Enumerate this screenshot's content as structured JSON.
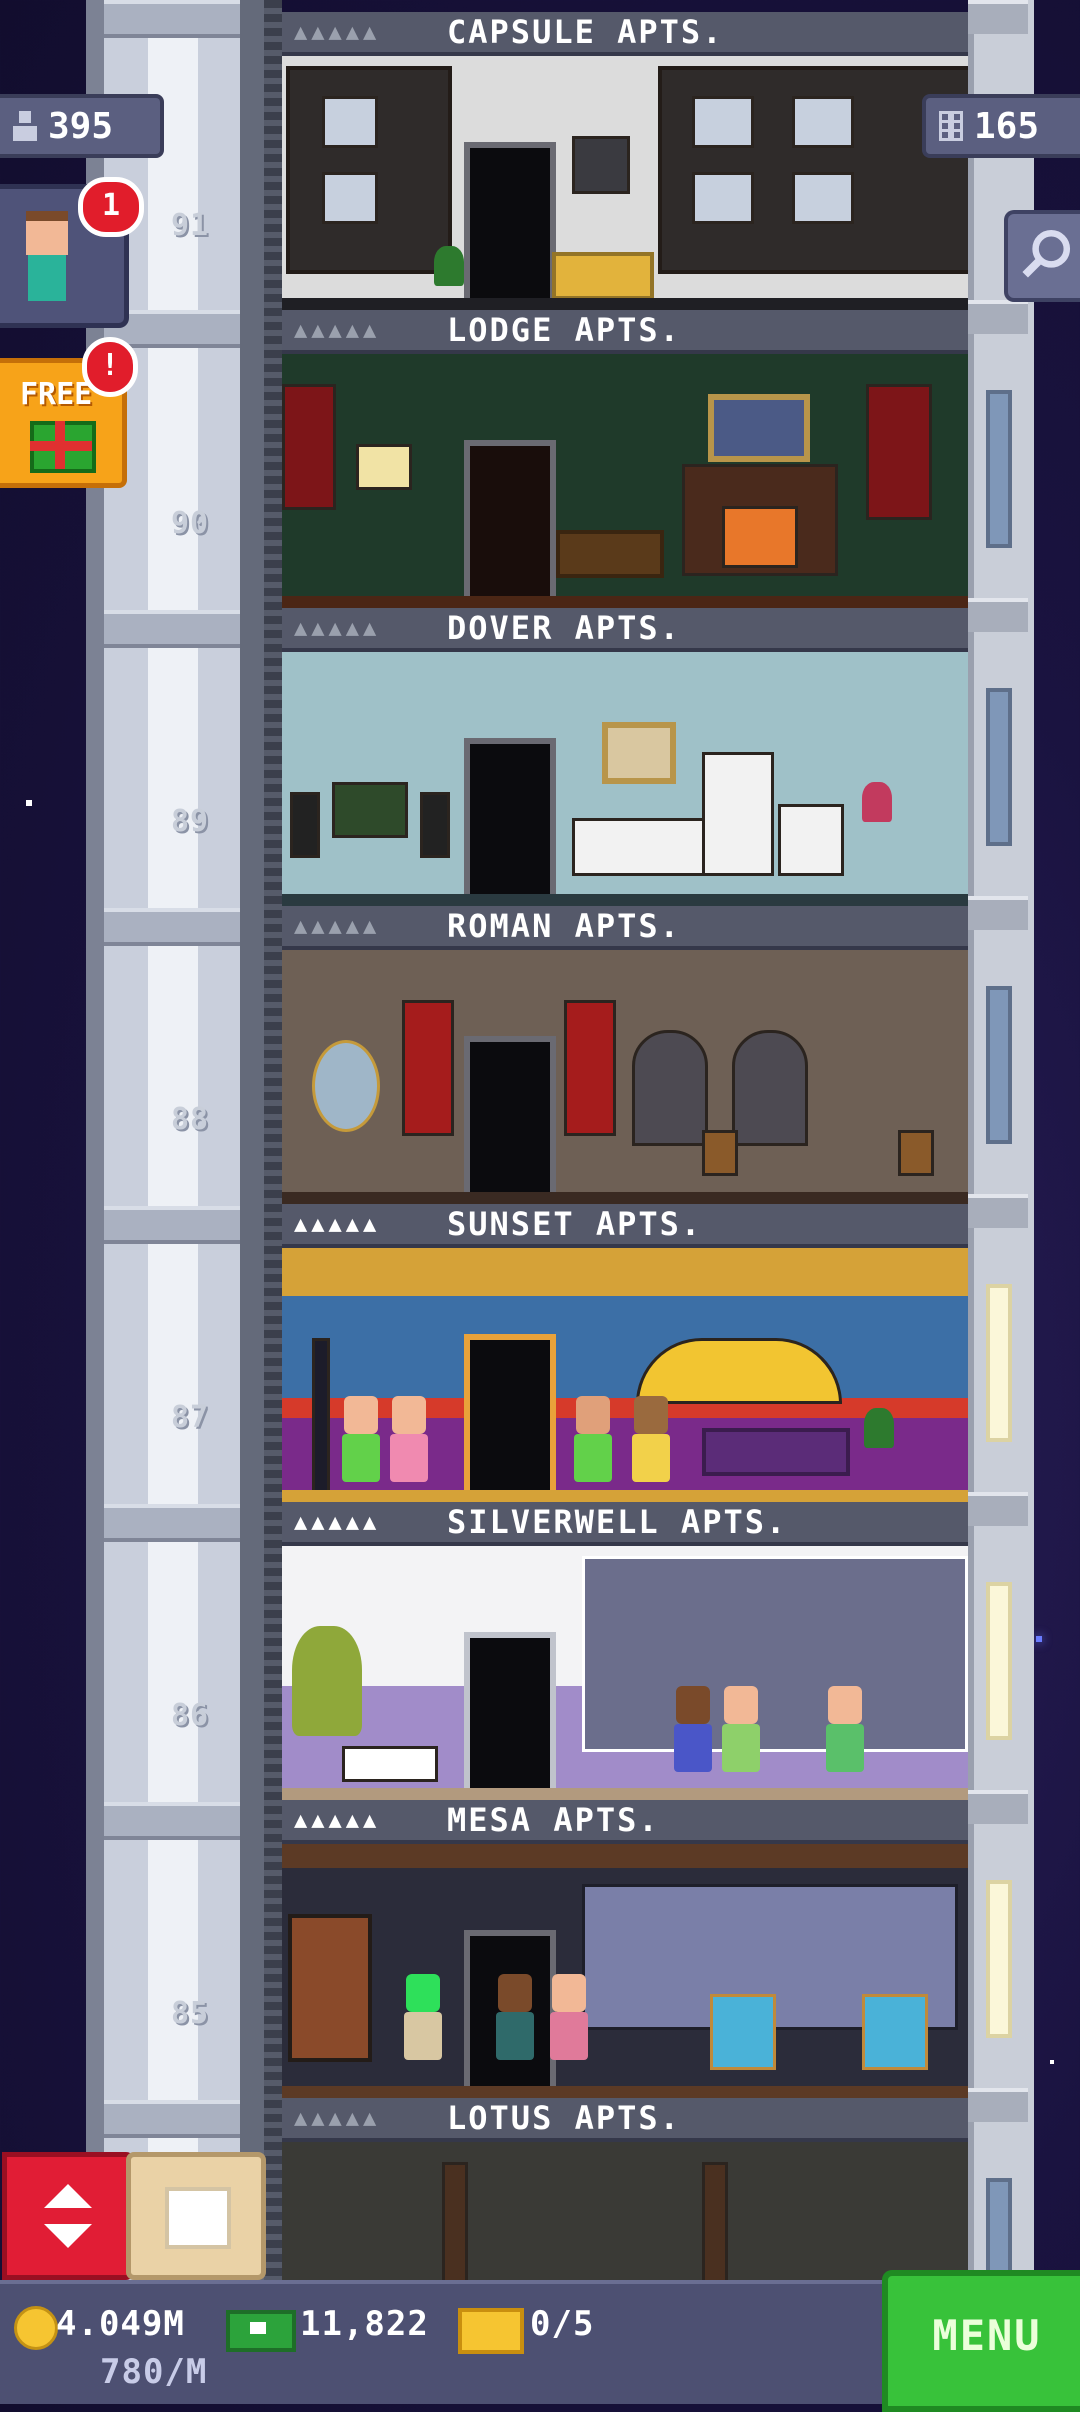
{
  "hud": {
    "population": "395",
    "floors_count": "165",
    "vip_alert_count": "1",
    "free_alert": "!",
    "free_label": "FREE",
    "coins": "4.049M",
    "coin_rate": "780/M",
    "tower_bux": "11,822",
    "tickets": "0/5",
    "menu_label": "MENU"
  },
  "floor_numbers": [
    "91",
    "90",
    "89",
    "88",
    "87",
    "86",
    "85"
  ],
  "floors": [
    {
      "name": "CAPSULE APTS.",
      "stars": "▲▲▲▲▲",
      "filled": false
    },
    {
      "name": "LODGE APTS.",
      "stars": "▲▲▲▲▲",
      "filled": false
    },
    {
      "name": "DOVER APTS.",
      "stars": "▲▲▲▲▲",
      "filled": false
    },
    {
      "name": "ROMAN APTS.",
      "stars": "▲▲▲▲▲",
      "filled": false
    },
    {
      "name": "SUNSET APTS.",
      "stars": "▲▲▲▲▲",
      "filled": true
    },
    {
      "name": "SILVERWELL APTS.",
      "stars": "▲▲▲▲▲",
      "filled": true
    },
    {
      "name": "MESA APTS.",
      "stars": "▲▲▲▲▲",
      "filled": true
    },
    {
      "name": "LOTUS APTS.",
      "stars": "▲▲▲▲▲",
      "filled": false
    }
  ],
  "icons": {
    "population": "person-icon",
    "floors": "building-icon",
    "search": "magnifier-icon",
    "elevator": "up-down-arrows-icon",
    "build": "crate-icon",
    "coin": "coin-icon",
    "bux": "tower-bux-icon",
    "ticket": "golden-ticket-icon"
  },
  "colors": {
    "menu": "#38c23a",
    "elevator_button": "#e11d35",
    "free_button": "#f7a319",
    "alert": "#e11d2b"
  }
}
